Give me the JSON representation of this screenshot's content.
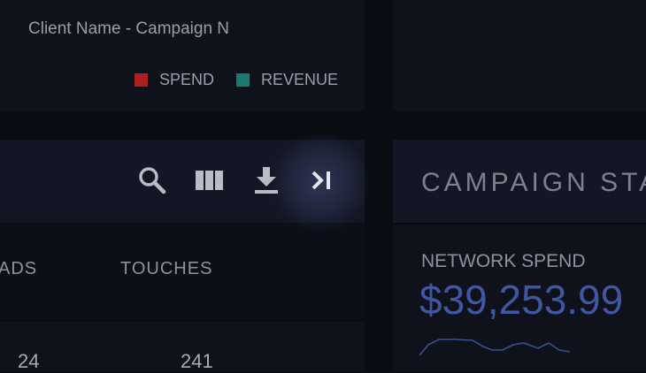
{
  "chart_legend": {
    "items": [
      {
        "label": "SPEND",
        "color": "#b11e22"
      },
      {
        "label": "REVENUE",
        "color": "#1b7a70"
      }
    ]
  },
  "client": {
    "title": "Client Name - Campaign N"
  },
  "toolbar": {
    "icons": [
      "search-icon",
      "columns-icon",
      "download-icon",
      "collapse-panel-icon"
    ]
  },
  "table": {
    "columns": [
      "ADS",
      "TOUCHES"
    ],
    "rows": [
      [
        "24",
        "241"
      ]
    ]
  },
  "stats": {
    "title": "CAMPAIGN STA",
    "metric_label": "NETWORK SPEND",
    "metric_value": "$39,253.99"
  },
  "colors": {
    "accent": "#3f57a3",
    "spend": "#b11e22",
    "revenue": "#1b7a70"
  }
}
